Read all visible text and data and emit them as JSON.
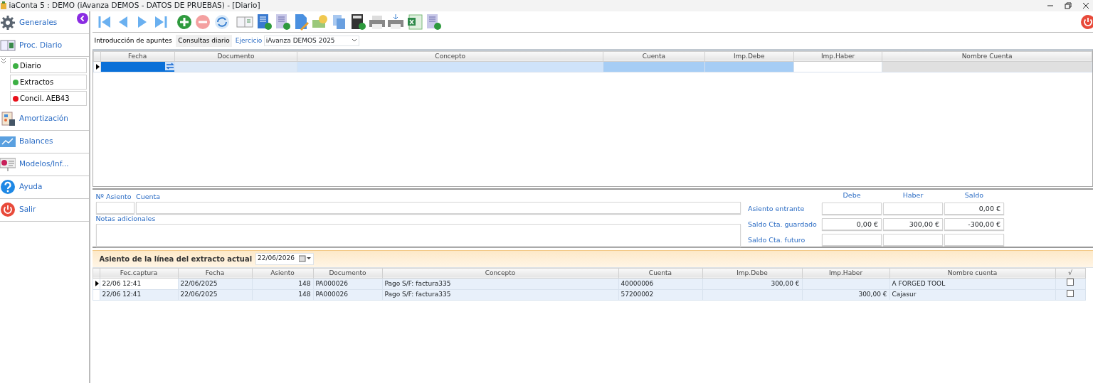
{
  "window": {
    "title": "iaConta 5 : DEMO (iAvanza DEMOS - DATOS DE PRUEBAS) - [Diario]"
  },
  "sidebar": {
    "items": [
      {
        "kind": "gear",
        "label": "Generales"
      },
      {
        "kind": "book",
        "label": "Proc. Diario",
        "expanded": true,
        "children": [
          {
            "label": "Diario",
            "color": "#3cb043"
          },
          {
            "label": "Extractos",
            "color": "#3cb043"
          },
          {
            "label": "Concil. AEB43",
            "color": "#e8101a"
          }
        ]
      },
      {
        "kind": "calc",
        "label": "Amortización"
      },
      {
        "kind": "chart",
        "label": "Balances"
      },
      {
        "kind": "board",
        "label": "Modelos/Inf..."
      },
      {
        "kind": "help",
        "label": "Ayuda"
      },
      {
        "kind": "power",
        "label": "Salir"
      }
    ]
  },
  "tabs": [
    {
      "label": "Introducción de apuntes",
      "selected": true
    },
    {
      "label": "Consultas diario",
      "selected": false
    }
  ],
  "ejercicio": {
    "label": "Ejercicio",
    "value": "iAvanza DEMOS 2025"
  },
  "entry_grid": {
    "columns": [
      "Fecha",
      "Documento",
      "Concepto",
      "Cuenta",
      "Imp.Debe",
      "Imp.Haber",
      "Nombre Cuenta"
    ]
  },
  "form": {
    "asiento_label": "Nº Asiento",
    "cuenta_label": "Cuenta",
    "notas_label": "Notas adicionales",
    "totals_headers": [
      "Debe",
      "Haber",
      "Saldo"
    ],
    "totals": [
      {
        "label": "Asiento entrante",
        "saldo": "0,00 €"
      },
      {
        "label": "Saldo Cta. guardado",
        "debe": "0,00 €",
        "haber": "300,00 €",
        "saldo": "-300,00 €"
      },
      {
        "label": "Saldo Cta. futuro"
      }
    ]
  },
  "extract": {
    "label": "Asiento de la línea del extracto actual",
    "date": "22/06/2026"
  },
  "lines_table": {
    "columns": [
      "Fec.captura",
      "Fecha",
      "Asiento",
      "Documento",
      "Concepto",
      "Cuenta",
      "Imp.Debe",
      "Imp.Haber",
      "Nombre cuenta",
      "√"
    ],
    "rows": [
      {
        "selected": true,
        "checked": false,
        "cells": [
          "22/06 12:41",
          "22/06/2025",
          "148",
          "PA000026",
          "Pago S/F: factura335",
          "40000006",
          "300,00 €",
          "",
          "A FORGED TOOL"
        ]
      },
      {
        "selected": false,
        "checked": false,
        "cells": [
          "22/06 12:41",
          "22/06/2025",
          "148",
          "PA000026",
          "Pago S/F: factura335",
          "57200002",
          "",
          "300,00 €",
          "Cajasur"
        ]
      }
    ]
  }
}
